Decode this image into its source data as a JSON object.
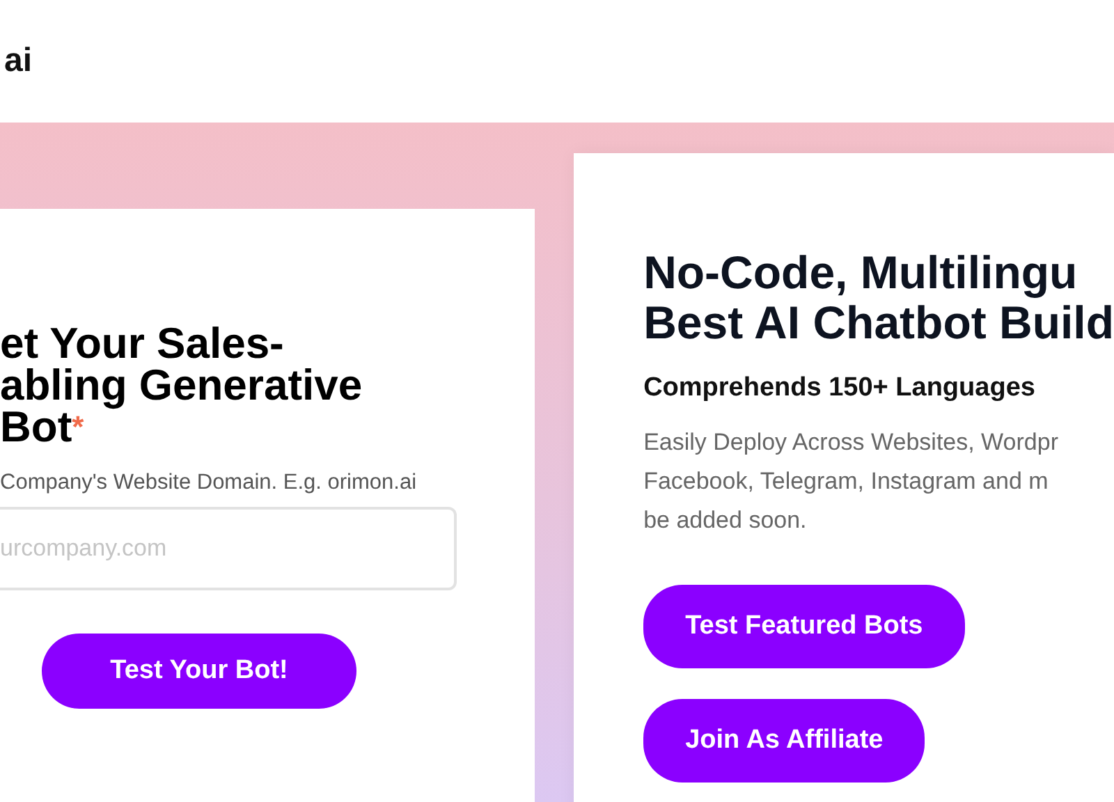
{
  "header": {
    "logo": "ai"
  },
  "signup_card": {
    "heading_lines": [
      "et Your Sales-",
      "abling Generative",
      "Bot"
    ],
    "required_mark": "*",
    "field_label": "Company's Website Domain. E.g. orimon.ai",
    "field": {
      "placeholder": "urcompany.com"
    },
    "button": "Test Your Bot!"
  },
  "info_card": {
    "heading_lines": [
      "No-Code, Multilingu",
      "Best AI Chatbot Build"
    ],
    "subheading": "Comprehends 150+ Languages",
    "body_lines": [
      "Easily Deploy Across Websites, Wordpr",
      "Facebook, Telegram, Instagram and m",
      "be added soon."
    ],
    "buttons": [
      "Test Featured Bots",
      "Join As Affiliate"
    ]
  }
}
